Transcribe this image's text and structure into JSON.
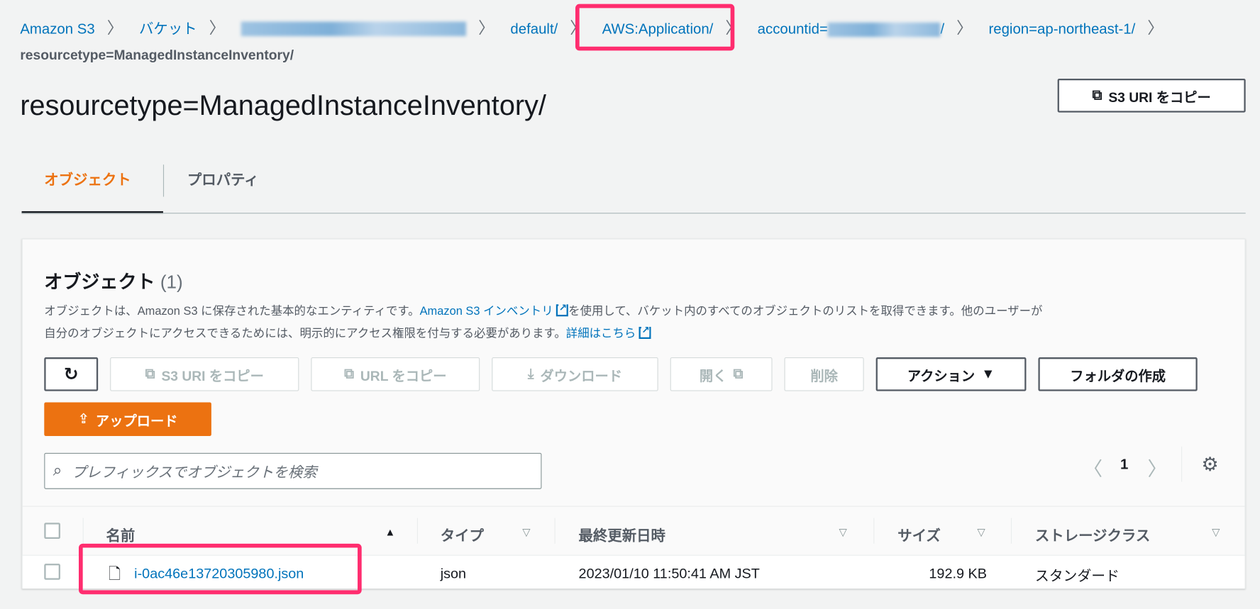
{
  "breadcrumb": {
    "items": [
      "Amazon S3",
      "バケット",
      "default/",
      "AWS:Application/",
      "accountid=",
      "/",
      "region=ap-northeast-1/"
    ],
    "current": "resourcetype=ManagedInstanceInventory/"
  },
  "page": {
    "title": "resourcetype=ManagedInstanceInventory/",
    "copy_uri": "S3 URI をコピー"
  },
  "tabs": [
    {
      "label": "オブジェクト",
      "active": true
    },
    {
      "label": "プロパティ"
    }
  ],
  "objects": {
    "heading": "オブジェクト",
    "count": "(1)",
    "desc1a": "オブジェクトは、Amazon S3 に保存された基本的なエンティティです。",
    "desc1link": "Amazon S3 インベントリ",
    "desc1b": "を使用して、バケット内のすべてのオブジェクトのリストを取得できます。他のユーザーが",
    "desc2a": "自分のオブジェクトにアクセスできるためには、明示的にアクセス権限を付与する必要があります。",
    "desc2link": "詳細はこちら",
    "buttons": {
      "copy_s3": "S3 URI をコピー",
      "copy_url": "URL をコピー",
      "download": "ダウンロード",
      "open": "開く",
      "delete": "削除",
      "actions": "アクション",
      "create_folder": "フォルダの作成",
      "upload": "アップロード"
    },
    "search_placeholder": "プレフィックスでオブジェクトを検索",
    "page_number": "1",
    "columns": [
      "名前",
      "タイプ",
      "最終更新日時",
      "サイズ",
      "ストレージクラス"
    ],
    "rows": [
      {
        "name": "i-0ac46e13720305980.json",
        "type": "json",
        "modified": "2023/01/10 11:50:41 AM JST",
        "size": "192.9 KB",
        "storage": "スタンダード"
      }
    ]
  },
  "colors": {
    "accent": "#ec7211",
    "link": "#0073bb",
    "highlight": "#ff2d6f"
  }
}
